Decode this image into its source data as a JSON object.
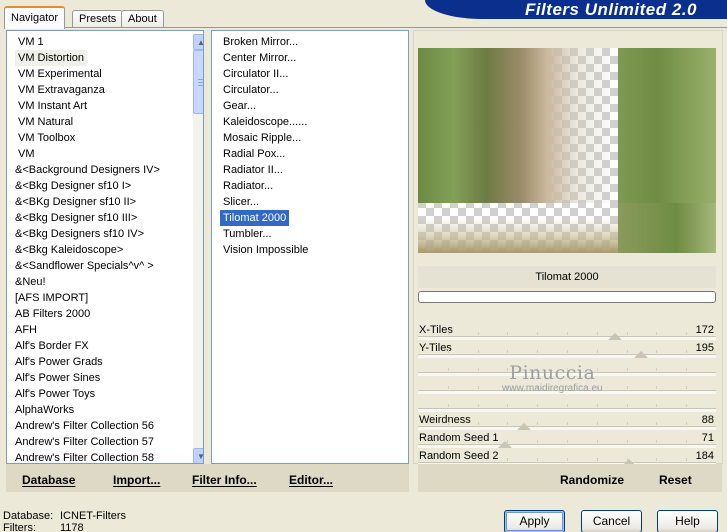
{
  "window": {
    "title": "Filters Unlimited 2.0"
  },
  "tabs": [
    {
      "label": "Navigator",
      "active": true
    },
    {
      "label": "Presets",
      "active": false
    },
    {
      "label": "About",
      "active": false
    }
  ],
  "categories": {
    "selected": "VM Distortion",
    "items": [
      "VM 1",
      "VM Distortion",
      "VM Experimental",
      "VM Extravaganza",
      "VM Instant Art",
      "VM Natural",
      "VM Toolbox",
      "VM",
      "&<Background Designers IV>",
      "&<Bkg Designer sf10 I>",
      "&<BKg Designer sf10 II>",
      "&<Bkg Designer sf10 III>",
      "&<Bkg Designers sf10 IV>",
      "&<Bkg Kaleidoscope>",
      "&<Sandflower Specials^v^ >",
      "&Neu!",
      "[AFS IMPORT]",
      "AB Filters 2000",
      "AFH",
      "Alf's Border FX",
      "Alf's Power Grads",
      "Alf's Power Sines",
      "Alf's Power Toys",
      "AlphaWorks",
      "Andrew's Filter Collection 56",
      "Andrew's Filter Collection 57",
      "Andrew's Filter Collection 58"
    ]
  },
  "filters": {
    "selected": "Tilomat 2000",
    "items": [
      "Broken Mirror...",
      "Center Mirror...",
      "Circulator II...",
      "Circulator...",
      "Gear...",
      "Kaleidoscope......",
      "Mosaic Ripple...",
      "Radial Pox...",
      "Radiator II...",
      "Radiator...",
      "Slicer...",
      "Tilomat 2000",
      "Tumbler...",
      "Vision Impossible"
    ]
  },
  "preview": {
    "filter_name": "Tilomat 2000",
    "colors": {
      "green": "#6c8a40",
      "tan": "#c8b79c"
    }
  },
  "parameters": [
    {
      "label": "X-Tiles",
      "value": "172",
      "level": 0.67
    },
    {
      "label": "Y-Tiles",
      "value": "195",
      "level": 0.76
    },
    {
      "label": "Weirdness",
      "value": "88",
      "level": 0.35
    },
    {
      "label": "Random Seed 1",
      "value": "71",
      "level": 0.28
    },
    {
      "label": "Random Seed 2",
      "value": "184",
      "level": 0.72
    }
  ],
  "watermark": {
    "line1": "Pinuccia",
    "line2": "www.maidiregrafica.eu"
  },
  "bottom_left_buttons": {
    "database": "Database",
    "import": "Import...",
    "filter_info": "Filter Info...",
    "editor": "Editor..."
  },
  "bottom_right_buttons": {
    "randomize": "Randomize",
    "reset": "Reset"
  },
  "status": {
    "database_label": "Database:",
    "database_value": "ICNET-Filters",
    "filters_label": "Filters:",
    "filters_value": "1178"
  },
  "dialog_buttons": {
    "apply": "Apply",
    "cancel": "Cancel",
    "help": "Help"
  }
}
